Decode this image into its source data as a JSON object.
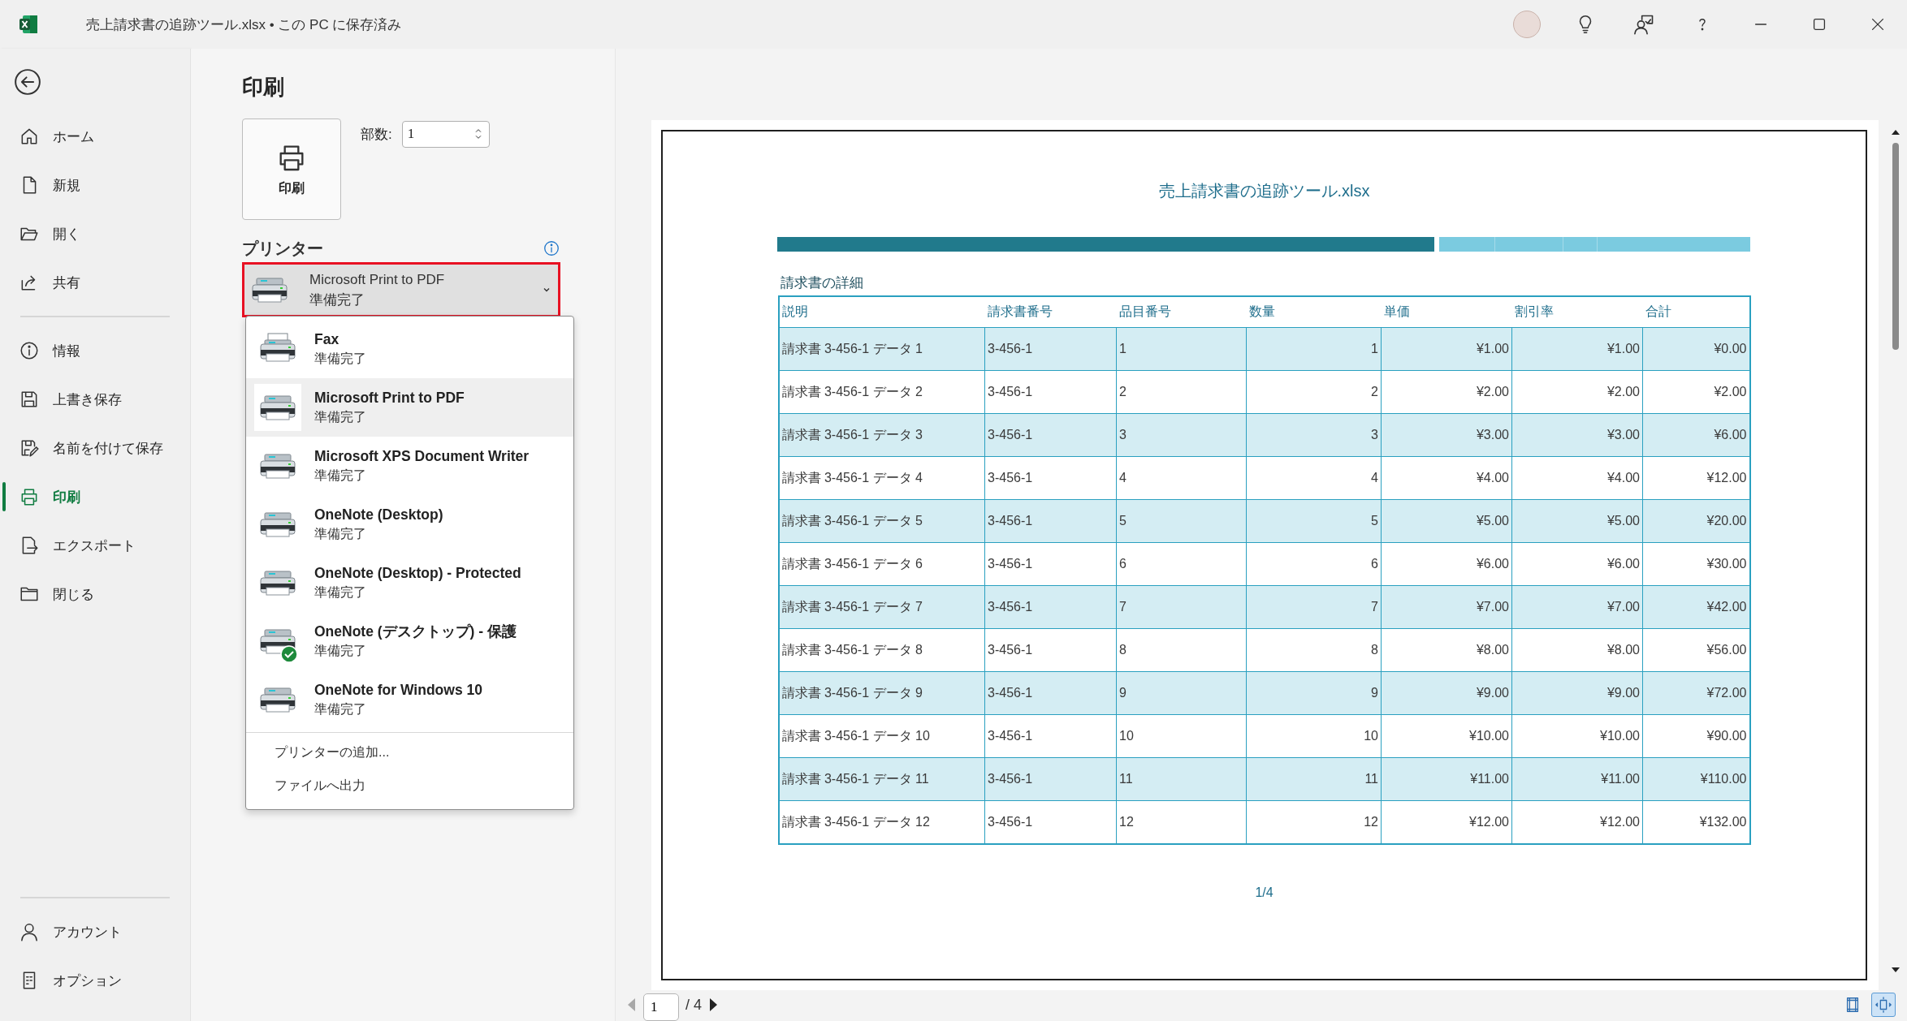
{
  "window": {
    "title": "売上請求書の追跡ツール.xlsx • この PC に保存済み"
  },
  "sidebar": {
    "sections": [
      {
        "items": [
          {
            "label": "ホーム",
            "selected": false
          },
          {
            "label": "新規",
            "selected": false
          },
          {
            "label": "開く",
            "selected": false
          },
          {
            "label": "共有",
            "selected": false
          }
        ]
      },
      {
        "items": [
          {
            "label": "情報",
            "selected": false
          },
          {
            "label": "上書き保存",
            "selected": false
          },
          {
            "label": "名前を付けて保存",
            "selected": false
          },
          {
            "label": "印刷",
            "selected": true
          },
          {
            "label": "エクスポート",
            "selected": false
          },
          {
            "label": "閉じる",
            "selected": false
          }
        ]
      },
      {
        "items": [
          {
            "label": "アカウント",
            "selected": false
          },
          {
            "label": "オプション",
            "selected": false
          }
        ]
      }
    ]
  },
  "print": {
    "title": "印刷",
    "print_button": "印刷",
    "copies_label": "部数:",
    "copies": "1",
    "printer_label": "プリンター",
    "printer": {
      "name": "Microsoft Print to PDF",
      "status": "準備完了",
      "highlighted": true,
      "expanded": true
    },
    "printers": [
      {
        "name": "Fax",
        "status": "準備完了",
        "kind": "fax",
        "selected": false,
        "default": false
      },
      {
        "name": "Microsoft Print to PDF",
        "status": "準備完了",
        "kind": "printer",
        "selected": true,
        "default": false
      },
      {
        "name": "Microsoft XPS Document Writer",
        "status": "準備完了",
        "kind": "printer",
        "selected": false,
        "default": false
      },
      {
        "name": "OneNote (Desktop)",
        "status": "準備完了",
        "kind": "printer",
        "selected": false,
        "default": false
      },
      {
        "name": "OneNote (Desktop) - Protected",
        "status": "準備完了",
        "kind": "printer",
        "selected": false,
        "default": false
      },
      {
        "name": "OneNote (デスクトップ) - 保護",
        "status": "準備完了",
        "kind": "printer",
        "selected": false,
        "default": true
      },
      {
        "name": "OneNote for Windows 10",
        "status": "準備完了",
        "kind": "printer",
        "selected": false,
        "default": false
      }
    ],
    "menu_actions": [
      "プリンターの追加...",
      "ファイルへ出力"
    ]
  },
  "preview": {
    "page_title": "売上請求書の追跡ツール.xlsx",
    "section_title": "請求書の詳細",
    "columns": [
      {
        "label": "説明",
        "kind": "text"
      },
      {
        "label": "請求書番号",
        "kind": "text"
      },
      {
        "label": "品目番号",
        "kind": "text"
      },
      {
        "label": "数量",
        "kind": "number"
      },
      {
        "label": "単価",
        "kind": "number"
      },
      {
        "label": "割引率",
        "kind": "number"
      },
      {
        "label": "合計",
        "kind": "number"
      }
    ],
    "rows": [
      [
        "請求書 3-456-1 データ 1",
        "3-456-1",
        "1",
        "1",
        "¥1.00",
        "¥1.00",
        "¥0.00"
      ],
      [
        "請求書 3-456-1 データ 2",
        "3-456-1",
        "2",
        "2",
        "¥2.00",
        "¥2.00",
        "¥2.00"
      ],
      [
        "請求書 3-456-1 データ 3",
        "3-456-1",
        "3",
        "3",
        "¥3.00",
        "¥3.00",
        "¥6.00"
      ],
      [
        "請求書 3-456-1 データ 4",
        "3-456-1",
        "4",
        "4",
        "¥4.00",
        "¥4.00",
        "¥12.00"
      ],
      [
        "請求書 3-456-1 データ 5",
        "3-456-1",
        "5",
        "5",
        "¥5.00",
        "¥5.00",
        "¥20.00"
      ],
      [
        "請求書 3-456-1 データ 6",
        "3-456-1",
        "6",
        "6",
        "¥6.00",
        "¥6.00",
        "¥30.00"
      ],
      [
        "請求書 3-456-1 データ 7",
        "3-456-1",
        "7",
        "7",
        "¥7.00",
        "¥7.00",
        "¥42.00"
      ],
      [
        "請求書 3-456-1 データ 8",
        "3-456-1",
        "8",
        "8",
        "¥8.00",
        "¥8.00",
        "¥56.00"
      ],
      [
        "請求書 3-456-1 データ 9",
        "3-456-1",
        "9",
        "9",
        "¥9.00",
        "¥9.00",
        "¥72.00"
      ],
      [
        "請求書 3-456-1 データ 10",
        "3-456-1",
        "10",
        "10",
        "¥10.00",
        "¥10.00",
        "¥90.00"
      ],
      [
        "請求書 3-456-1 データ 11",
        "3-456-1",
        "11",
        "11",
        "¥11.00",
        "¥11.00",
        "¥110.00"
      ],
      [
        "請求書 3-456-1 データ 12",
        "3-456-1",
        "12",
        "12",
        "¥12.00",
        "¥12.00",
        "¥132.00"
      ]
    ],
    "page_label": "1/4"
  },
  "page_nav": {
    "page": "1",
    "total": "/ 4",
    "prev_enabled": false,
    "next_enabled": true
  },
  "view_buttons": [
    {
      "kind": "margins",
      "selected": false
    },
    {
      "kind": "zoom",
      "selected": true
    }
  ]
}
